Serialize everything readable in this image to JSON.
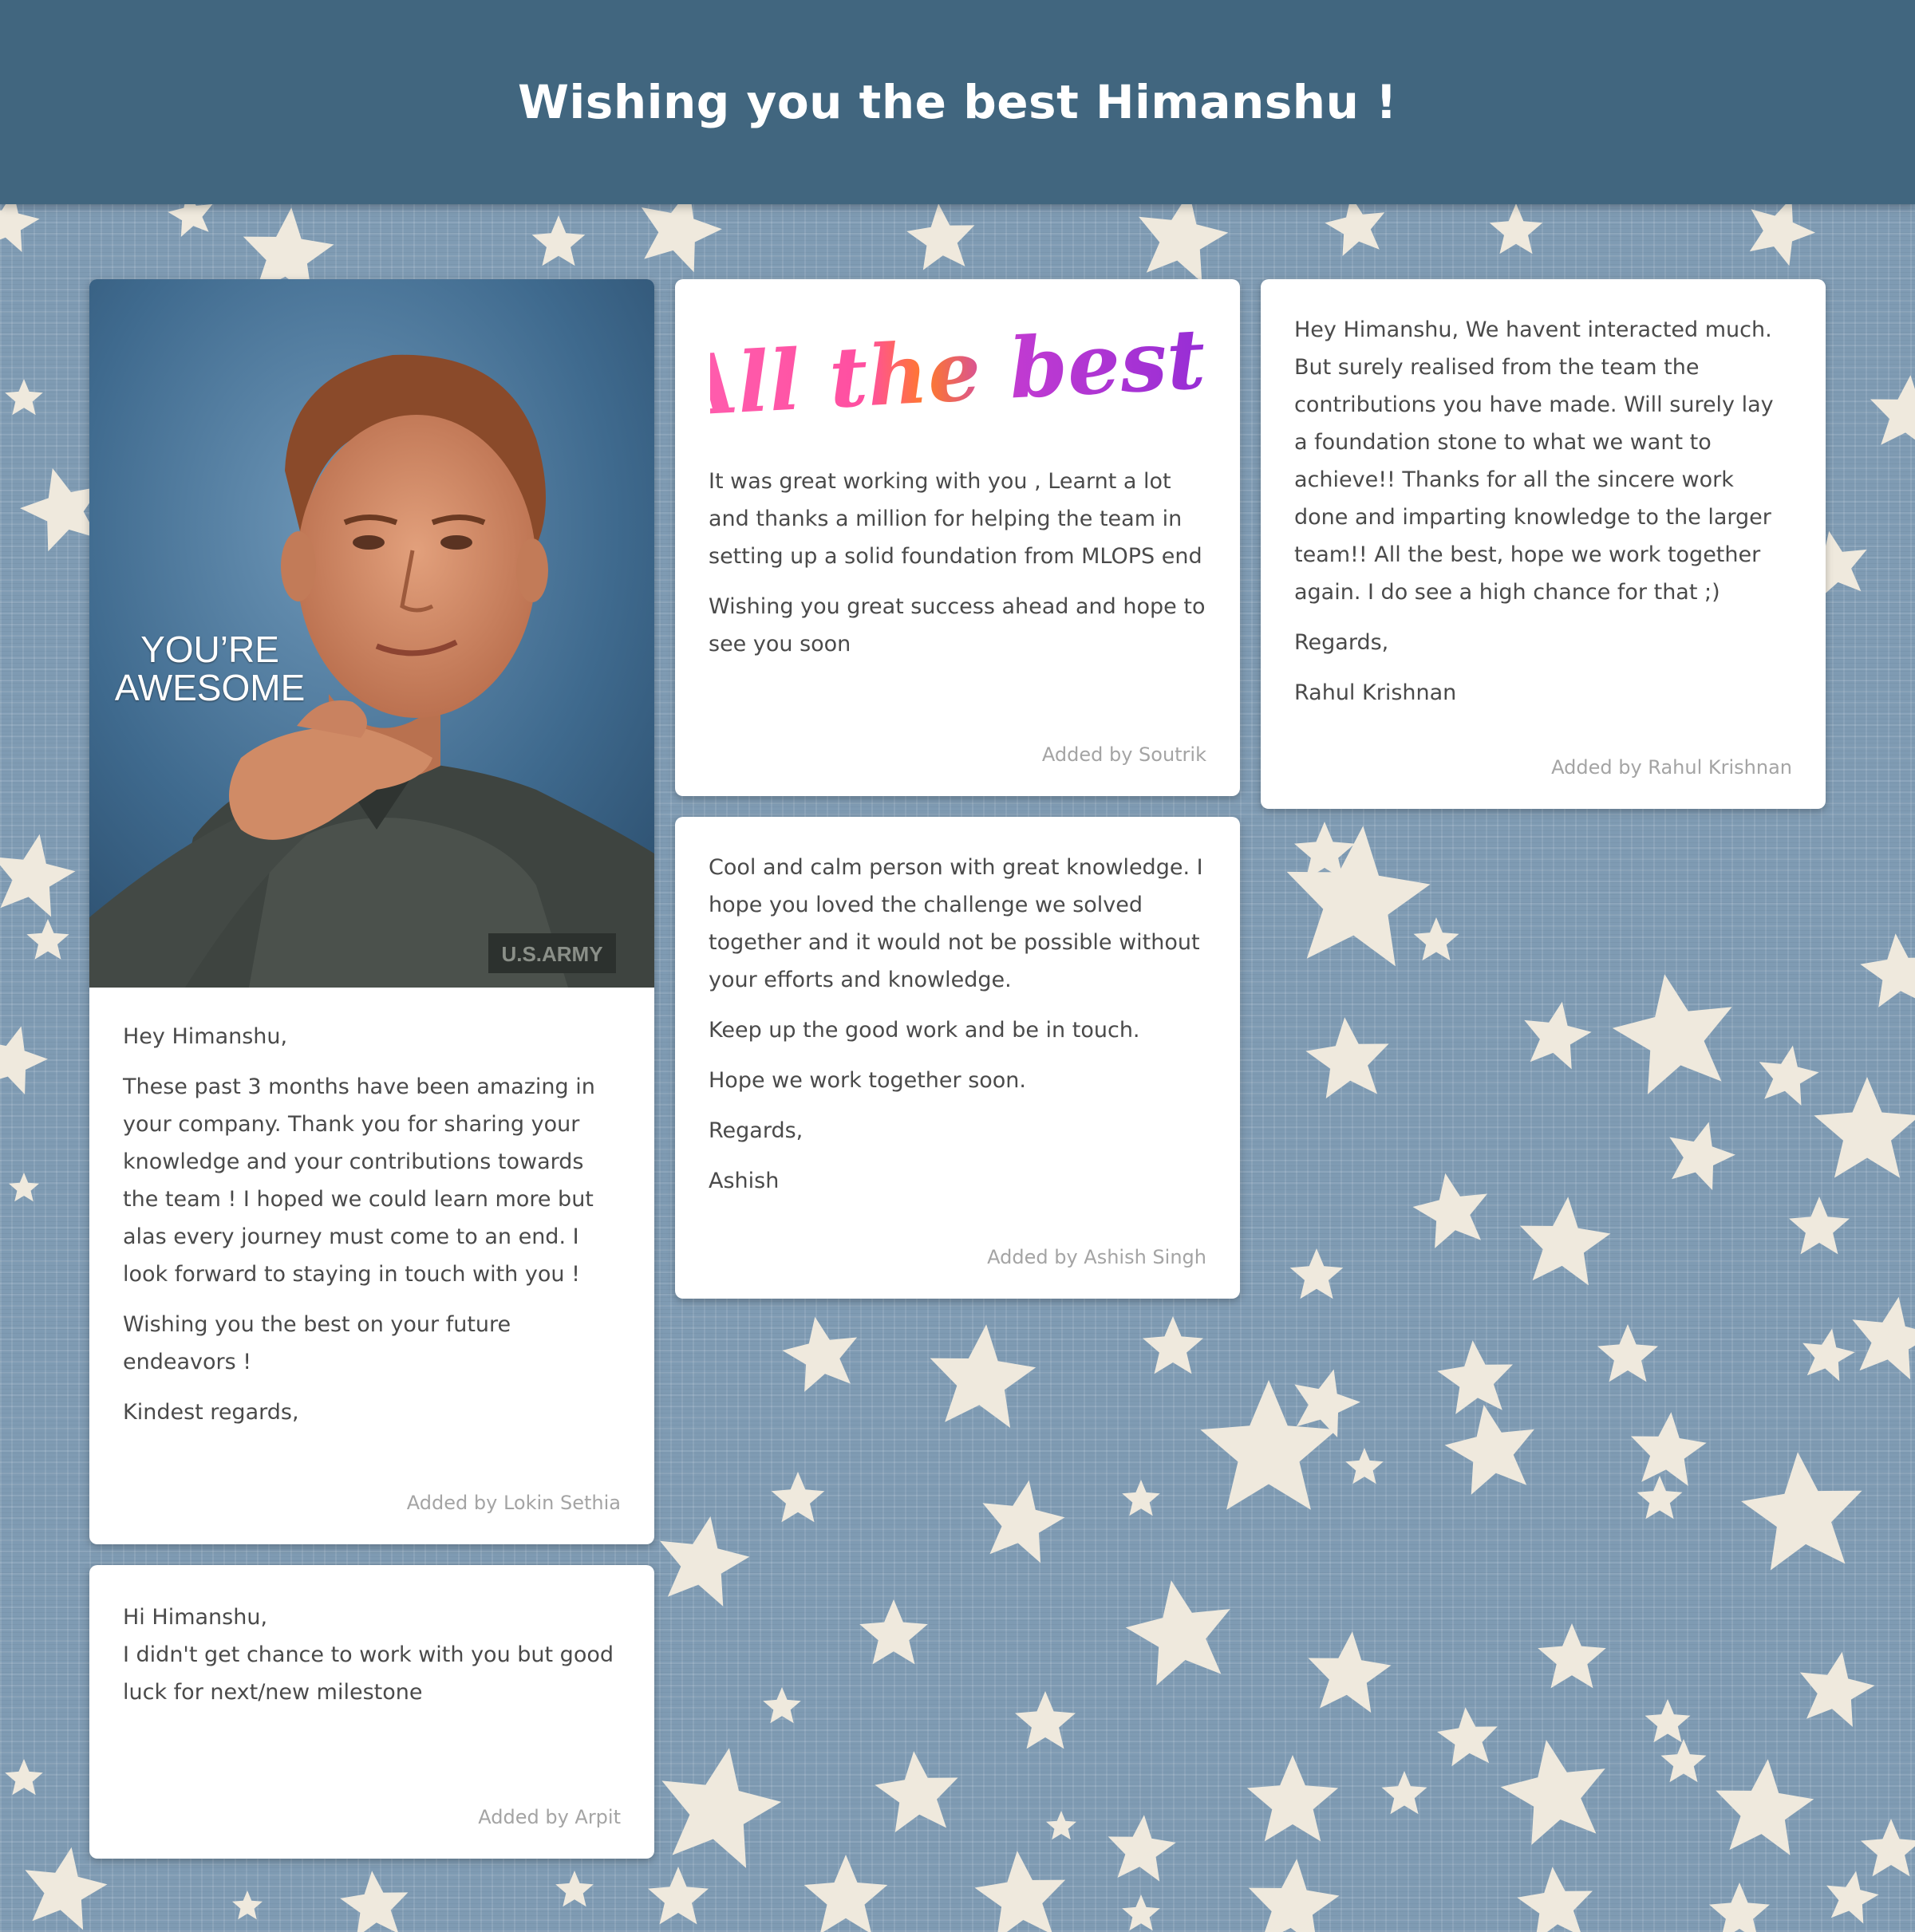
{
  "header": {
    "title": "Wishing you the best Himanshu !"
  },
  "cards": {
    "lokin": {
      "image_caption_line1": "YOU’RE",
      "image_caption_line2": "AWESOME",
      "paragraphs": [
        "Hey Himanshu,",
        "These past 3 months have been amazing in your company. Thank you for sharing your knowledge and your contributions towards the team ! I hoped we could learn more but alas every journey must come to an end. I look forward to staying in touch with you !",
        "Wishing you the best on your future endeavors !",
        "Kindest regards,"
      ],
      "author": "Added by Lokin Sethia"
    },
    "arpit": {
      "line1": "Hi Himanshu,",
      "line2": "I didn't get chance to work with you but good luck for next/new milestone",
      "author": "Added by Arpit"
    },
    "soutrik": {
      "image_text": "All the best!",
      "paragraphs": [
        "It was great working with you , Learnt a lot and thanks a million for helping the team in setting up a solid foundation from MLOPS end",
        "Wishing you great success ahead and hope to see you soon"
      ],
      "author": "Added by Soutrik"
    },
    "ashish": {
      "paragraphs": [
        "Cool and calm person with great knowledge. I hope you loved the challenge we solved together and it would not be possible without your efforts and knowledge.",
        "Keep up the good work and be in touch.",
        "Hope we work together soon.",
        "Regards,",
        "Ashish"
      ],
      "author": "Added by Ashish Singh"
    },
    "rahul": {
      "paragraphs": [
        "Hey Himanshu, We havent interacted much. But surely realised from the team the contributions you have made. Will surely lay a foundation stone to what we want to achieve!! Thanks for all the sincere work done and imparting knowledge to the larger team!! All the best, hope we work together again. I do see a high chance for that ;)",
        "Regards,",
        "Rahul Krishnan"
      ],
      "author": "Added by Rahul Krishnan"
    }
  },
  "colors": {
    "header_bg": "#41667f",
    "page_bg": "#7f9bb3",
    "star": "#efe9dd",
    "card_bg": "#ffffff",
    "text": "#4a4a4a",
    "author_text": "#a4a4a4"
  }
}
